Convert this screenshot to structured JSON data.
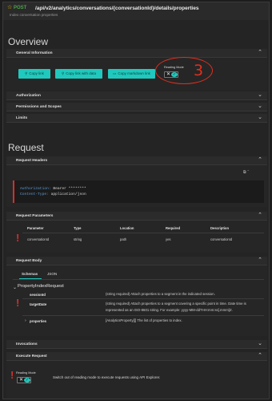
{
  "header": {
    "method": "POST",
    "path": "/api/v2/analytics/conversations/{conversationId}/details/properties",
    "subtitle": "Index conversation properties"
  },
  "overview": {
    "title": "Overview",
    "general_information": "General Information",
    "buttons": {
      "copy_link": "Copy link",
      "copy_link_with_data": "Copy link with data",
      "copy_markdown_link": "Copy markdown link"
    },
    "reading_mode_label": "Reading Mode",
    "annotation_number": "3",
    "sections": [
      "Authorization",
      "Permissions and Scopes",
      "Limits"
    ]
  },
  "request": {
    "title": "Request",
    "headers_title": "Request Headers",
    "header_lines": [
      {
        "key": "Authorization:",
        "value": "Bearer ********"
      },
      {
        "key": "Content-Type:",
        "value": "application/json"
      }
    ],
    "parameters_title": "Request Parameters",
    "param_columns": [
      "Parameter",
      "Type",
      "Location",
      "Required",
      "Description"
    ],
    "param_row": [
      "conversationId",
      "string",
      "path",
      "yes",
      "conversationId"
    ],
    "body_title": "Request Body",
    "body_tabs": [
      "Schemas",
      "JSON"
    ],
    "schema_name": "PropertyIndexRequest",
    "properties": [
      {
        "name": "sessionId",
        "description": "(string required) Attach properties to a segment in the indicated session."
      },
      {
        "name": "targetDate",
        "description": "(string required) Attach properties to a segment covering a specific point in time. Date time is represented as an ISO-8601 string. For example: yyyy-MM-ddTHH:mm:ss[.mmm]Z."
      },
      {
        "name": "properties",
        "description": "[AnalyticsProperty[]] The list of properties to index."
      }
    ]
  },
  "invocations_title": "Invocations",
  "execute": {
    "title": "Execute Request",
    "reading_mode_label": "Reading Mode",
    "message": "Switch out of reading mode to execute requests using API Explorer."
  },
  "colors": {
    "accent": "#1fc9bd",
    "required": "#d0312d",
    "post": "#4aa34a",
    "annotation": "#e0301f"
  }
}
